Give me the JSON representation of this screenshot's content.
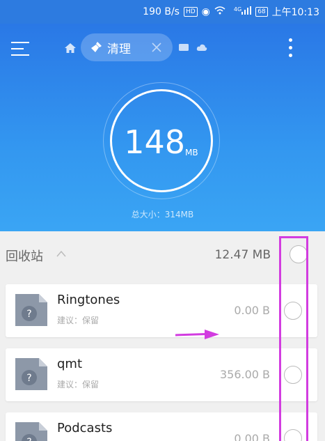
{
  "status_bar": {
    "speed": "190 B/s",
    "hd_badge": "HD",
    "network": "4G",
    "battery": "68",
    "time": "上午10:13"
  },
  "toolbar": {
    "active_tab_label": "清理"
  },
  "summary": {
    "cleanable_value": "148",
    "cleanable_unit": "MB",
    "total_label": "总大小：314MB"
  },
  "recycle_bin": {
    "title": "回收站",
    "size": "12.47 MB"
  },
  "items": [
    {
      "name": "Ringtones",
      "suggestion": "建议：保留",
      "size": "0.00 B"
    },
    {
      "name": "qmt",
      "suggestion": "建议：保留",
      "size": "356.00 B"
    },
    {
      "name": "Podcasts",
      "suggestion": "",
      "size": "0.00 B"
    }
  ],
  "colors": {
    "header_blue": "#2d7be0",
    "annotation_magenta": "#d23ce0"
  }
}
